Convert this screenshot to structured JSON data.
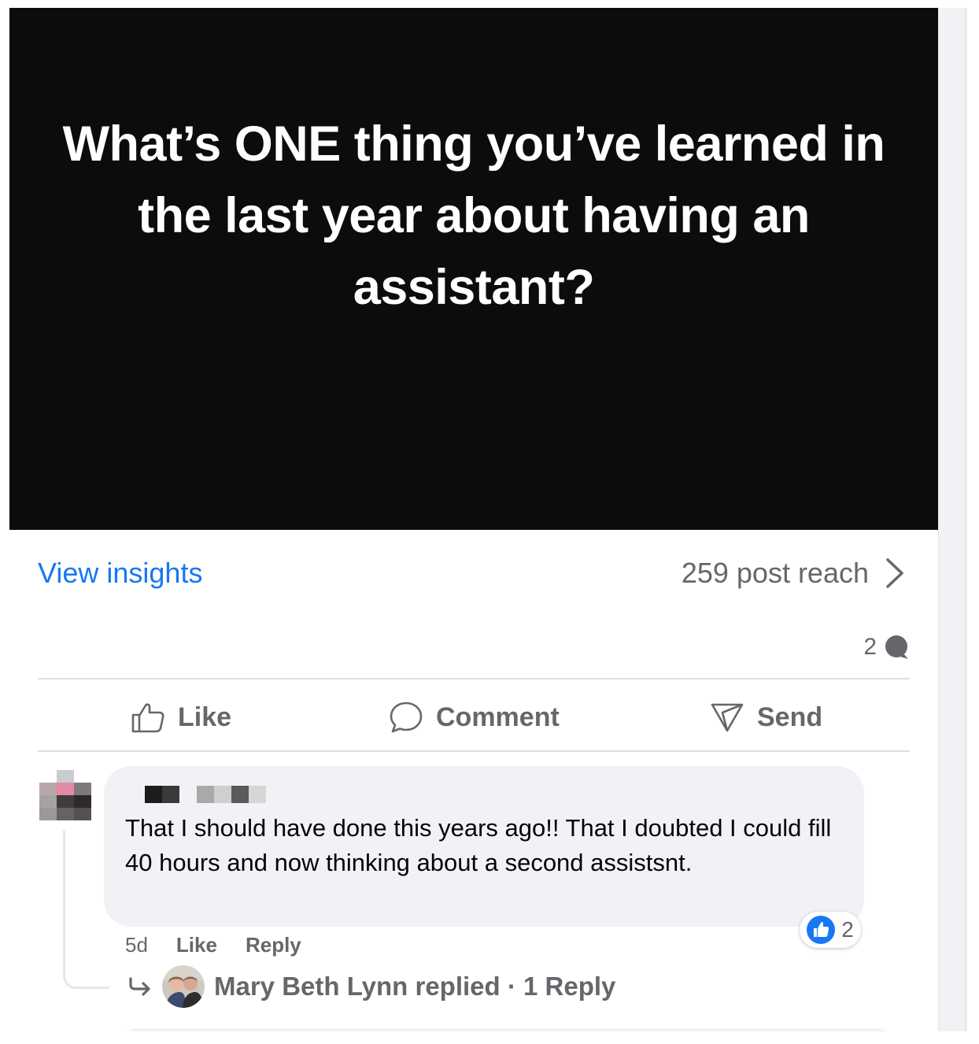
{
  "post": {
    "image_text": "What’s ONE thing you’ve learned in the last year about having an assistant?",
    "view_insights": "View insights",
    "post_reach": "259 post reach",
    "comment_count": "2"
  },
  "actions": {
    "like": "Like",
    "comment": "Comment",
    "send": "Send"
  },
  "comment": {
    "text": "That I should have done this years ago!! That I doubted I could fill 40 hours and now thinking about a second assistsnt.",
    "reaction_count": "2",
    "time": "5d",
    "like": "Like",
    "reply": "Reply"
  },
  "replies": {
    "summary": "Mary Beth Lynn replied · 1 Reply"
  },
  "colors": {
    "accent": "#1877f2",
    "secondary_text": "#65676b",
    "bubble": "#f0f2f5"
  }
}
